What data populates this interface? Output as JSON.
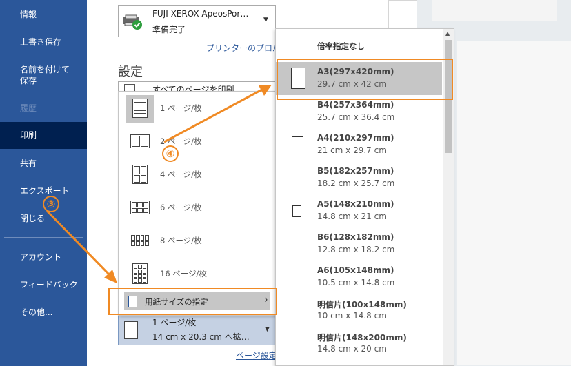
{
  "sidebar": {
    "items": [
      {
        "label": "情報"
      },
      {
        "label": "上書き保存"
      },
      {
        "label": "名前を付けて保存"
      },
      {
        "label": "履歴"
      },
      {
        "label": "印刷"
      },
      {
        "label": "共有"
      },
      {
        "label": "エクスポート"
      },
      {
        "label": "閉じる"
      },
      {
        "label": "アカウント"
      },
      {
        "label": "フィードバック"
      },
      {
        "label": "その他..."
      }
    ]
  },
  "printer": {
    "name": "FUJI XEROX ApeosPor…",
    "status": "準備完了",
    "properties_link": "プリンターのプロパティ"
  },
  "settings": {
    "heading": "設定",
    "print_all": "すべてのページを印刷",
    "pages_per_sheet_label": "1 ページ/枚",
    "pages_per_sheet_detail": "14 cm x 20.3 cm へ拡…",
    "page_setup_link": "ページ設定"
  },
  "layout_menu": {
    "items": [
      {
        "label": "1 ページ/枚"
      },
      {
        "label": "2 ページ/枚"
      },
      {
        "label": "4 ページ/枚"
      },
      {
        "label": "6 ページ/枚"
      },
      {
        "label": "8 ページ/枚"
      },
      {
        "label": "16 ページ/枚"
      }
    ],
    "paper_size_item": "用紙サイズの指定",
    "paper_size_arrow": "›"
  },
  "paper_menu": {
    "header": "倍率指定なし",
    "items": [
      {
        "name": "A3(297x420mm)",
        "dims": "29.7 cm x 42 cm"
      },
      {
        "name": "B4(257x364mm)",
        "dims": "25.7 cm x 36.4 cm"
      },
      {
        "name": "A4(210x297mm)",
        "dims": "21 cm x 29.7 cm"
      },
      {
        "name": "B5(182x257mm)",
        "dims": "18.2 cm x 25.7 cm"
      },
      {
        "name": "A5(148x210mm)",
        "dims": "14.8 cm x 21 cm"
      },
      {
        "name": "B6(128x182mm)",
        "dims": "12.8 cm x 18.2 cm"
      },
      {
        "name": "A6(105x148mm)",
        "dims": "10.5 cm x 14.8 cm"
      },
      {
        "name": "明信片(100x148mm)",
        "dims": "10 cm x 14.8 cm"
      },
      {
        "name": "明信片(148x200mm)",
        "dims": "14.8 cm x 20 cm"
      }
    ]
  },
  "annotations": {
    "step3": "③",
    "step4": "④",
    "color": "#f08a24"
  },
  "colors": {
    "sidebar_bg": "#2b579a",
    "sidebar_active": "#002050",
    "highlight": "#c6c6c6"
  }
}
